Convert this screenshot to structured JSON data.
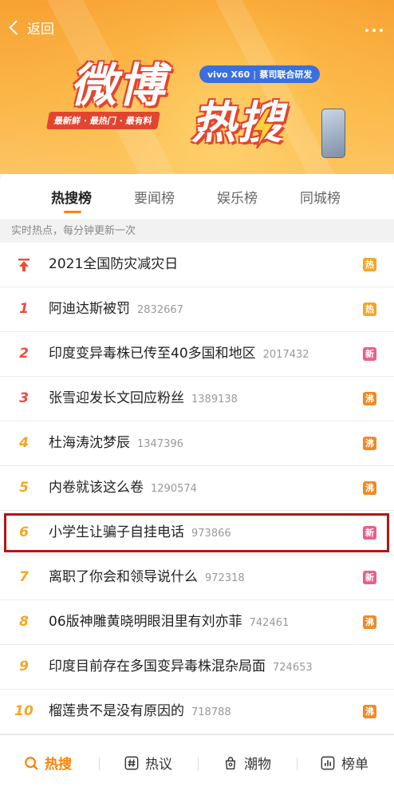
{
  "header": {
    "back_label": "返回",
    "logo_top": "微博",
    "logo_bottom": "热搜",
    "slogan": "最新鲜 · 最热门 · 最有料",
    "sponsor_brand": "vivo X60",
    "sponsor_text": "蔡司联合研发"
  },
  "tabs": [
    {
      "label": "热搜榜",
      "active": true
    },
    {
      "label": "要闻榜",
      "active": false
    },
    {
      "label": "娱乐榜",
      "active": false
    },
    {
      "label": "同城榜",
      "active": false
    }
  ],
  "subtitle": "实时热点，每分钟更新一次",
  "list": [
    {
      "rank": "",
      "title": "2021全国防灾减灾日",
      "count": "",
      "badge": "热",
      "badge_color": "#f5a623",
      "rank_color": "#ea4b3c"
    },
    {
      "rank": "1",
      "title": "阿迪达斯被罚",
      "count": "2832667",
      "badge": "热",
      "badge_color": "#f5a623",
      "rank_color": "#ea4b3c"
    },
    {
      "rank": "2",
      "title": "印度变异毒株已传至40多国和地区",
      "count": "2017432",
      "badge": "新",
      "badge_color": "#ea5e8b",
      "rank_color": "#ea4b3c"
    },
    {
      "rank": "3",
      "title": "张雪迎发长文回应粉丝",
      "count": "1389138",
      "badge": "沸",
      "badge_color": "#f08a25",
      "rank_color": "#ea4b3c"
    },
    {
      "rank": "4",
      "title": "杜海涛沈梦辰",
      "count": "1347396",
      "badge": "沸",
      "badge_color": "#f08a25",
      "rank_color": "#f5a623"
    },
    {
      "rank": "5",
      "title": "内卷就该这么卷",
      "count": "1290574",
      "badge": "沸",
      "badge_color": "#f08a25",
      "rank_color": "#f5a623"
    },
    {
      "rank": "6",
      "title": "小学生让骗子自挂电话",
      "count": "973866",
      "badge": "新",
      "badge_color": "#ea5e8b",
      "rank_color": "#f5a623"
    },
    {
      "rank": "7",
      "title": "离职了你会和领导说什么",
      "count": "972318",
      "badge": "新",
      "badge_color": "#ea5e8b",
      "rank_color": "#f5a623"
    },
    {
      "rank": "8",
      "title": "06版神雕黄晓明眼泪里有刘亦菲",
      "count": "742461",
      "badge": "沸",
      "badge_color": "#f08a25",
      "rank_color": "#f5a623"
    },
    {
      "rank": "9",
      "title": "印度目前存在多国变异毒株混杂局面",
      "count": "724653",
      "badge": "",
      "badge_color": "",
      "rank_color": "#f5a623"
    },
    {
      "rank": "10",
      "title": "榴莲贵不是没有原因的",
      "count": "718788",
      "badge": "沸",
      "badge_color": "#f08a25",
      "rank_color": "#f5a623"
    }
  ],
  "bottom_nav": [
    {
      "label": "热搜",
      "icon": "search-hot-icon",
      "active": true
    },
    {
      "label": "热议",
      "icon": "hashtag-icon",
      "active": false
    },
    {
      "label": "潮物",
      "icon": "bag-icon",
      "active": false
    },
    {
      "label": "榜单",
      "icon": "bar-chart-icon",
      "active": false
    }
  ],
  "colors": {
    "accent": "#ff8200",
    "highlight_box": "#b3141a",
    "rank_top3": "#ea4b3c",
    "rank_rest": "#f5a623"
  }
}
